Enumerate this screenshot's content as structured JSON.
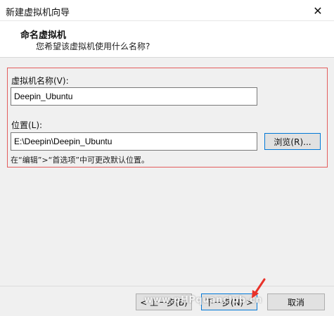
{
  "window": {
    "title": "新建虚拟机向导",
    "close_glyph": "✕"
  },
  "header": {
    "title": "命名虚拟机",
    "description": "您希望该虚拟机使用什么名称?"
  },
  "form": {
    "vm_name_label": "虚拟机名称(V):",
    "vm_name_value": "Deepin_Ubuntu",
    "location_label": "位置(L):",
    "location_value": "E:\\Deepin\\Deepin_Ubuntu",
    "browse_label": "浏览(R)...",
    "hint": "在“编辑”>“首选项”中可更改默认位置。"
  },
  "footer": {
    "back_label": "< 上一步(B)",
    "next_label": "下一步(N) >",
    "cancel_label": "取消"
  },
  "watermark": "www.pHPquanclub.cn",
  "colors": {
    "highlight_border": "#e35d5d",
    "focus_border": "#0078d7",
    "arrow": "#e8322a"
  }
}
